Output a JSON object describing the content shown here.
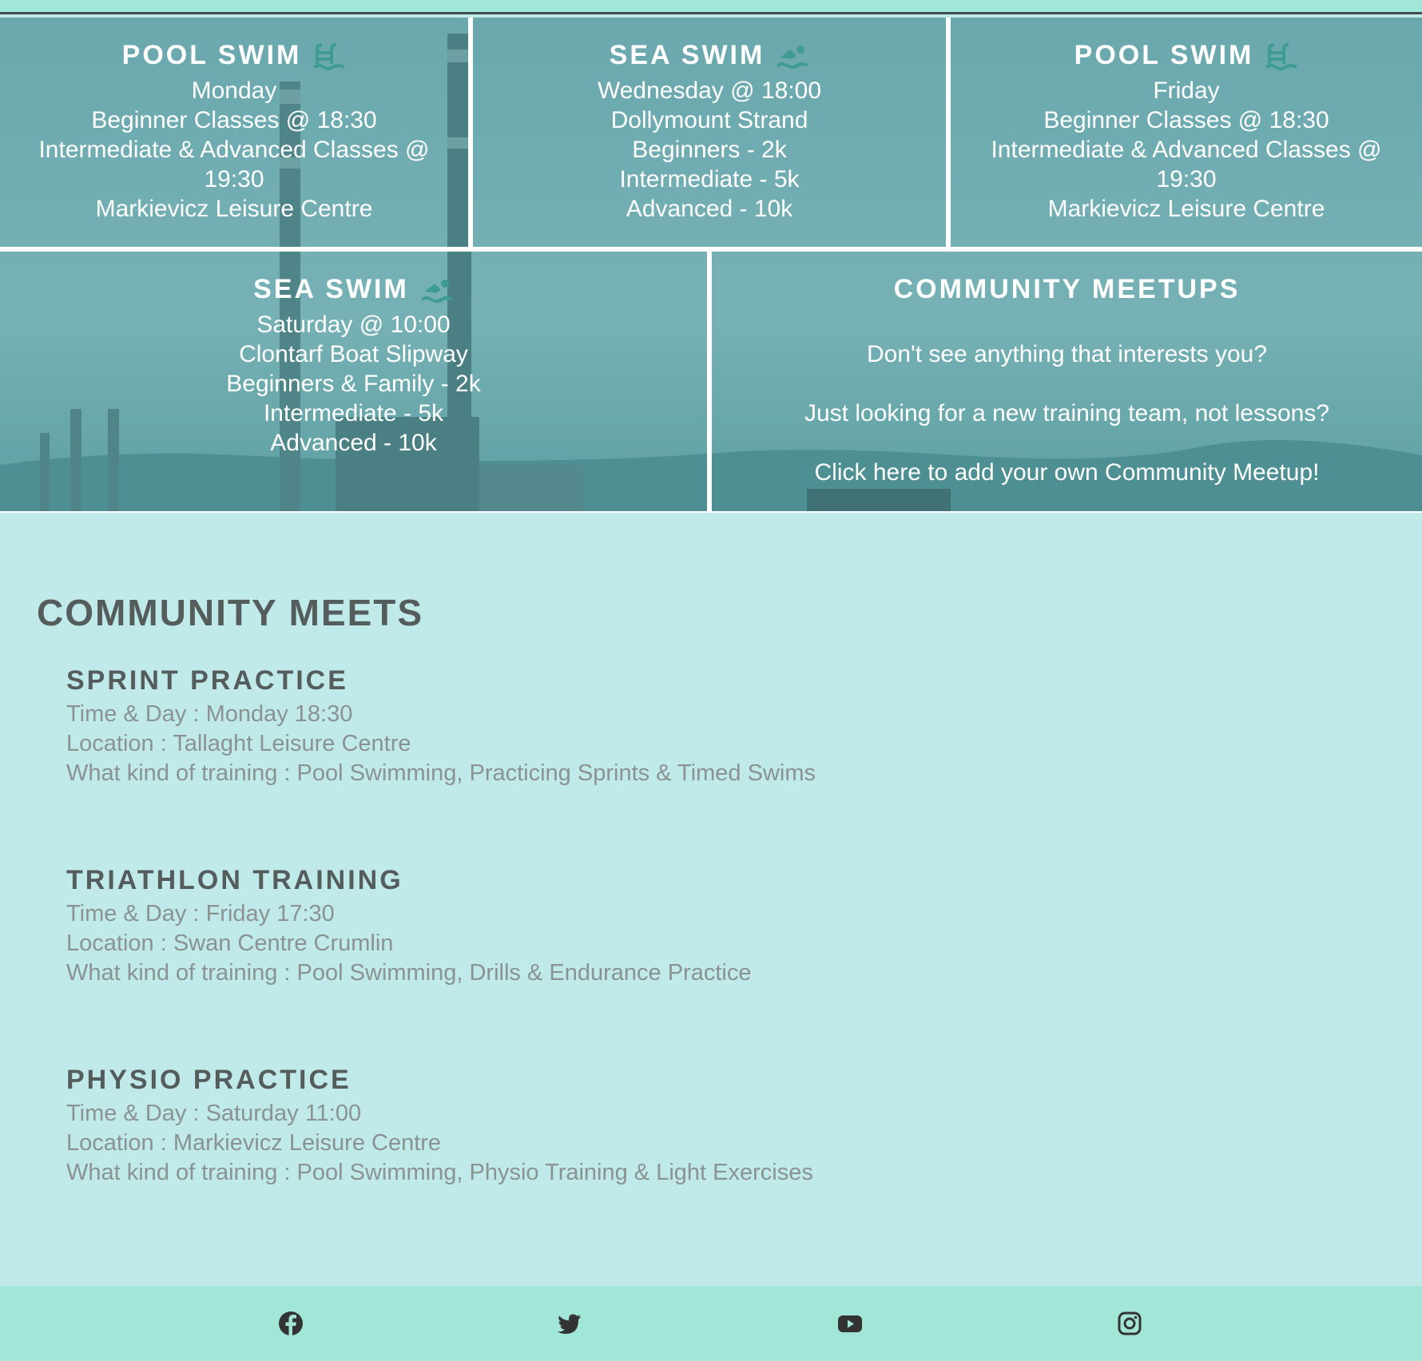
{
  "schedule": {
    "cards": [
      {
        "title": "POOL SWIM",
        "icon": "pool-icon",
        "lines": [
          "Monday",
          "Beginner Classes @ 18:30",
          "Intermediate & Advanced Classes @",
          "19:30",
          "Markievicz Leisure Centre"
        ]
      },
      {
        "title": "SEA SWIM",
        "icon": "swimmer-icon",
        "lines": [
          "Wednesday @ 18:00",
          "Dollymount Strand",
          "Beginners - 2k",
          "Intermediate - 5k",
          "Advanced - 10k"
        ]
      },
      {
        "title": "POOL SWIM",
        "icon": "pool-icon",
        "lines": [
          "Friday",
          "Beginner Classes @ 18:30",
          "Intermediate & Advanced Classes @",
          "19:30",
          "Markievicz Leisure Centre"
        ]
      },
      {
        "title": "SEA SWIM",
        "icon": "swimmer-icon",
        "lines": [
          "Saturday @ 10:00",
          "Clontarf Boat Slipway",
          "Beginners & Family - 2k",
          "Intermediate - 5k",
          "Advanced - 10k"
        ]
      }
    ],
    "community": {
      "title": "COMMUNITY MEETUPS",
      "lines": [
        "Don't see anything that interests you?",
        "Just looking for a new training team, not lessons?",
        "Click here to add your own Community Meetup!"
      ]
    }
  },
  "meets": {
    "heading": "COMMUNITY MEETS",
    "items": [
      {
        "title": "SPRINT PRACTICE",
        "time": "Time & Day : Monday 18:30",
        "location": "Location : Tallaght Leisure Centre",
        "training": "What kind of training : Pool Swimming, Practicing Sprints & Timed Swims"
      },
      {
        "title": "TRIATHLON TRAINING",
        "time": "Time & Day : Friday 17:30",
        "location": "Location : Swan Centre Crumlin",
        "training": "What kind of training : Pool Swimming, Drills & Endurance Practice"
      },
      {
        "title": "PHYSIO PRACTICE",
        "time": "Time & Day : Saturday 11:00",
        "location": "Location : Markievicz Leisure Centre",
        "training": "What kind of training : Pool Swimming, Physio Training & Light Exercises"
      }
    ]
  },
  "footer": {
    "icons": [
      "facebook-icon",
      "twitter-icon",
      "youtube-icon",
      "instagram-icon"
    ]
  },
  "colors": {
    "accent": "#a2e6d8",
    "background": "#c0eaea",
    "overlay": "#5aa3a8",
    "heading": "#555c5c",
    "body_text": "#8a9292",
    "icon": "#3f9c92"
  }
}
